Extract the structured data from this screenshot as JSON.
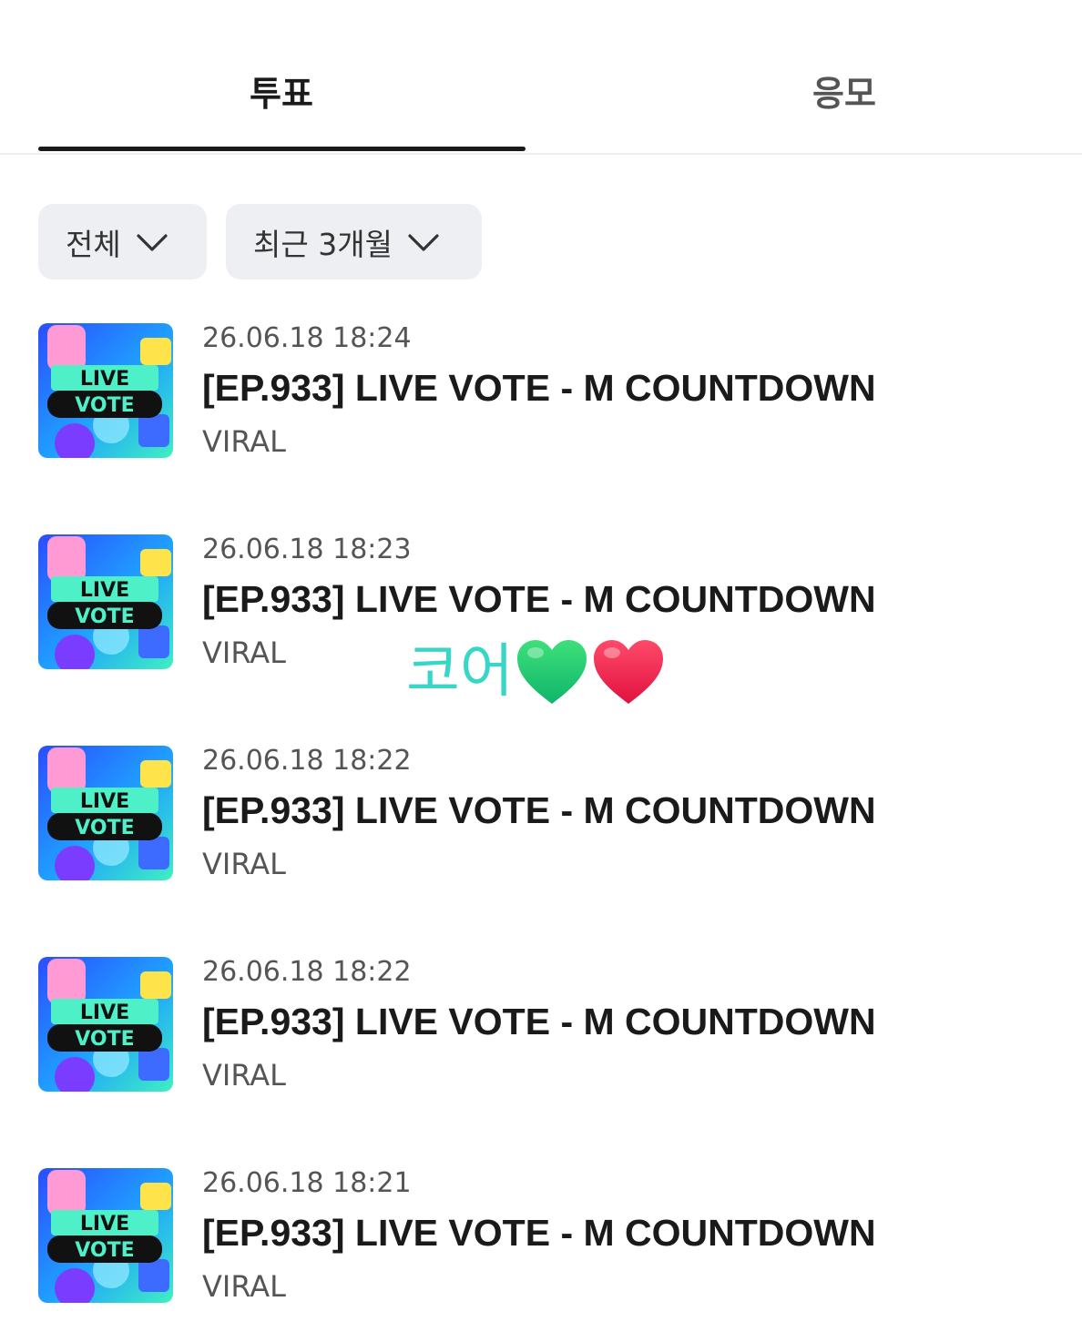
{
  "tabs": [
    {
      "label": "투표",
      "active": true
    },
    {
      "label": "응모",
      "active": false
    }
  ],
  "filters": {
    "category": "전체",
    "period": "최근 3개월"
  },
  "thumbnail": {
    "line1": "LIVE",
    "line2": "VOTE"
  },
  "items": [
    {
      "date": "26.06.18 18:24",
      "title": "[EP.933] LIVE VOTE - M COUNTDOWN",
      "category": "VIRAL"
    },
    {
      "date": "26.06.18 18:23",
      "title": "[EP.933] LIVE VOTE - M COUNTDOWN",
      "category": "VIRAL"
    },
    {
      "date": "26.06.18 18:22",
      "title": "[EP.933] LIVE VOTE - M COUNTDOWN",
      "category": "VIRAL"
    },
    {
      "date": "26.06.18 18:22",
      "title": "[EP.933] LIVE VOTE - M COUNTDOWN",
      "category": "VIRAL"
    },
    {
      "date": "26.06.18 18:21",
      "title": "[EP.933] LIVE VOTE - M COUNTDOWN",
      "category": "VIRAL"
    }
  ],
  "overlay": {
    "text": "코어",
    "hearts": [
      "green-heart",
      "red-heart"
    ]
  },
  "colors": {
    "overlay_text": "#37d6c6",
    "tab_indicator": "#1a1a1a",
    "chip_bg": "#eeeff2"
  }
}
